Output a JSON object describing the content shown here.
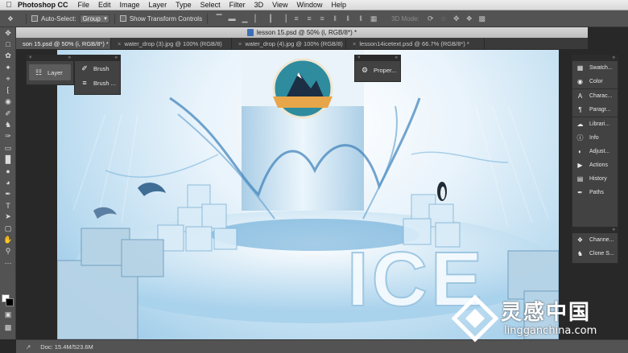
{
  "menubar": {
    "app_name": "Photoshop CC",
    "items": [
      "File",
      "Edit",
      "Image",
      "Layer",
      "Type",
      "Select",
      "Filter",
      "3D",
      "View",
      "Window",
      "Help"
    ]
  },
  "options_bar": {
    "auto_select_label": "Auto-Select:",
    "auto_select_value": "Group",
    "show_transform_label": "Show Transform Controls",
    "mode_3d_label": "3D Mode:"
  },
  "document": {
    "title": "lesson 15.psd @ 50% (i, RGB/8*) *"
  },
  "tabs": [
    {
      "label": "son 15.psd @ 50% (i, RGB/8*) *",
      "active": true
    },
    {
      "label": "water_drop (3).jpg @ 100% (RGB/8)",
      "active": false
    },
    {
      "label": "water_drop (4).jpg @ 100% (RGB/8)",
      "active": false
    },
    {
      "label": "lesson14icetext.psd @ 66.7% (RGB/8*) *",
      "active": false
    }
  ],
  "left_panels": {
    "layers_label": "Layer",
    "brush_label": "Brush",
    "brush_presets_label": "Brush ...",
    "properties_label": "Proper..."
  },
  "right_panels": {
    "group1": [
      "Swatch...",
      "Color"
    ],
    "group2": [
      "Charac...",
      "Paragr..."
    ],
    "group3": [
      "Librari...",
      "Info",
      "Adjust...",
      "Actions",
      "History",
      "Paths"
    ],
    "group4": [
      "Channe...",
      "Clone S..."
    ]
  },
  "canvas": {
    "ice_text": "ICE"
  },
  "statusbar": {
    "doc_info": "Doc: 15.4M/523.6M"
  },
  "watermark": {
    "text_cn": "灵感中国",
    "url": "lingganchina.com"
  },
  "colors": {
    "ui_dark": "#282828",
    "ui_panel": "#424242",
    "ui_mid": "#535353",
    "sky_light": "#e8f3fb",
    "sky_blue": "#8ec2e4",
    "water_blue": "#2a6fae"
  }
}
